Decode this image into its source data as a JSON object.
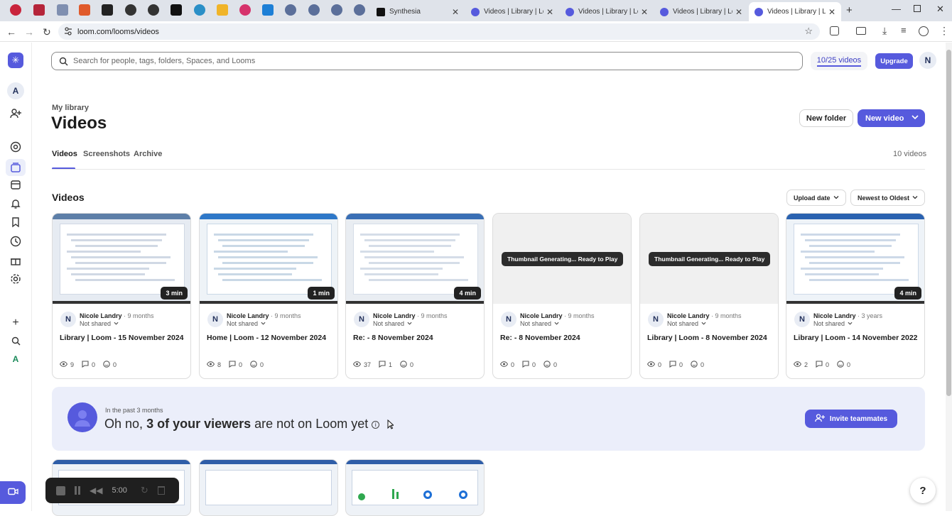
{
  "browser": {
    "tabs": [
      {
        "title": "Synthesia",
        "active": false
      },
      {
        "title": "Videos | Library | Loom",
        "active": false
      },
      {
        "title": "Videos | Library | Loom",
        "active": false
      },
      {
        "title": "Videos | Library | Loom",
        "active": false
      },
      {
        "title": "Videos | Library | Loom",
        "active": true
      }
    ],
    "url": "loom.com/looms/videos"
  },
  "rail": {
    "workspace_initial": "A",
    "bottom_initial": "A"
  },
  "header": {
    "search_placeholder": "Search for people, tags, folders, Spaces, and Looms",
    "video_quota": "10/25 videos",
    "upgrade_label": "Upgrade",
    "user_initial": "N"
  },
  "page": {
    "breadcrumb": "My library",
    "title": "Videos",
    "new_folder_label": "New folder",
    "new_video_label": "New video",
    "tabs": [
      "Videos",
      "Screenshots",
      "Archive"
    ],
    "video_count": "10 videos",
    "section_title": "Videos",
    "sort_field": "Upload date",
    "sort_order": "Newest to Oldest"
  },
  "videos": [
    {
      "author": "Nicole Landry",
      "age": "9 months",
      "share": "Not shared",
      "title": "Library | Loom - 15 November 2024",
      "duration": "3 min",
      "views": "9",
      "comments": "0",
      "reactions": "0",
      "thumb": "screen"
    },
    {
      "author": "Nicole Landry",
      "age": "9 months",
      "share": "Not shared",
      "title": "Home | Loom - 12 November 2024",
      "duration": "1 min",
      "views": "8",
      "comments": "0",
      "reactions": "0",
      "thumb": "screen"
    },
    {
      "author": "Nicole Landry",
      "age": "9 months",
      "share": "Not shared",
      "title": "Re: - 8 November 2024",
      "duration": "4 min",
      "views": "37",
      "comments": "1",
      "reactions": "0",
      "thumb": "screen"
    },
    {
      "author": "Nicole Landry",
      "age": "9 months",
      "share": "Not shared",
      "title": "Re: - 8 November 2024",
      "duration": "",
      "views": "0",
      "comments": "0",
      "reactions": "0",
      "thumb": "generating",
      "generating_text": "Thumbnail Generating... Ready to Play"
    },
    {
      "author": "Nicole Landry",
      "age": "9 months",
      "share": "Not shared",
      "title": "Library | Loom - 8 November 2024",
      "duration": "",
      "views": "0",
      "comments": "0",
      "reactions": "0",
      "thumb": "generating",
      "generating_text": "Thumbnail Generating... Ready to Play"
    },
    {
      "author": "Nicole Landry",
      "age": "3 years",
      "share": "Not shared",
      "title": "Library | Loom - 14 November 2022",
      "duration": "4 min",
      "views": "2",
      "comments": "0",
      "reactions": "0",
      "thumb": "screen"
    }
  ],
  "banner": {
    "kicker": "In the past 3 months",
    "text_pre": "Oh no,",
    "text_bold": "3 of your viewers",
    "text_post": "are not on Loom yet",
    "invite_label": "Invite teammates"
  },
  "recorder": {
    "time": "5:00"
  },
  "help": {
    "label": "?"
  },
  "colors": {
    "brand": "#565add",
    "brand_dark": "#3d3fc4",
    "banner_bg": "#ebeefa"
  },
  "icons": [
    "loom-logo-icon",
    "add-person-icon",
    "at-icon",
    "library-icon",
    "calendar-icon",
    "bell-icon",
    "bookmark-icon",
    "clock-icon",
    "gift-icon",
    "gear-icon",
    "plus-icon",
    "search-icon",
    "eye-icon",
    "comment-icon",
    "reaction-icon",
    "chevron-down-icon",
    "invite-icon",
    "camera-icon",
    "help-icon"
  ]
}
